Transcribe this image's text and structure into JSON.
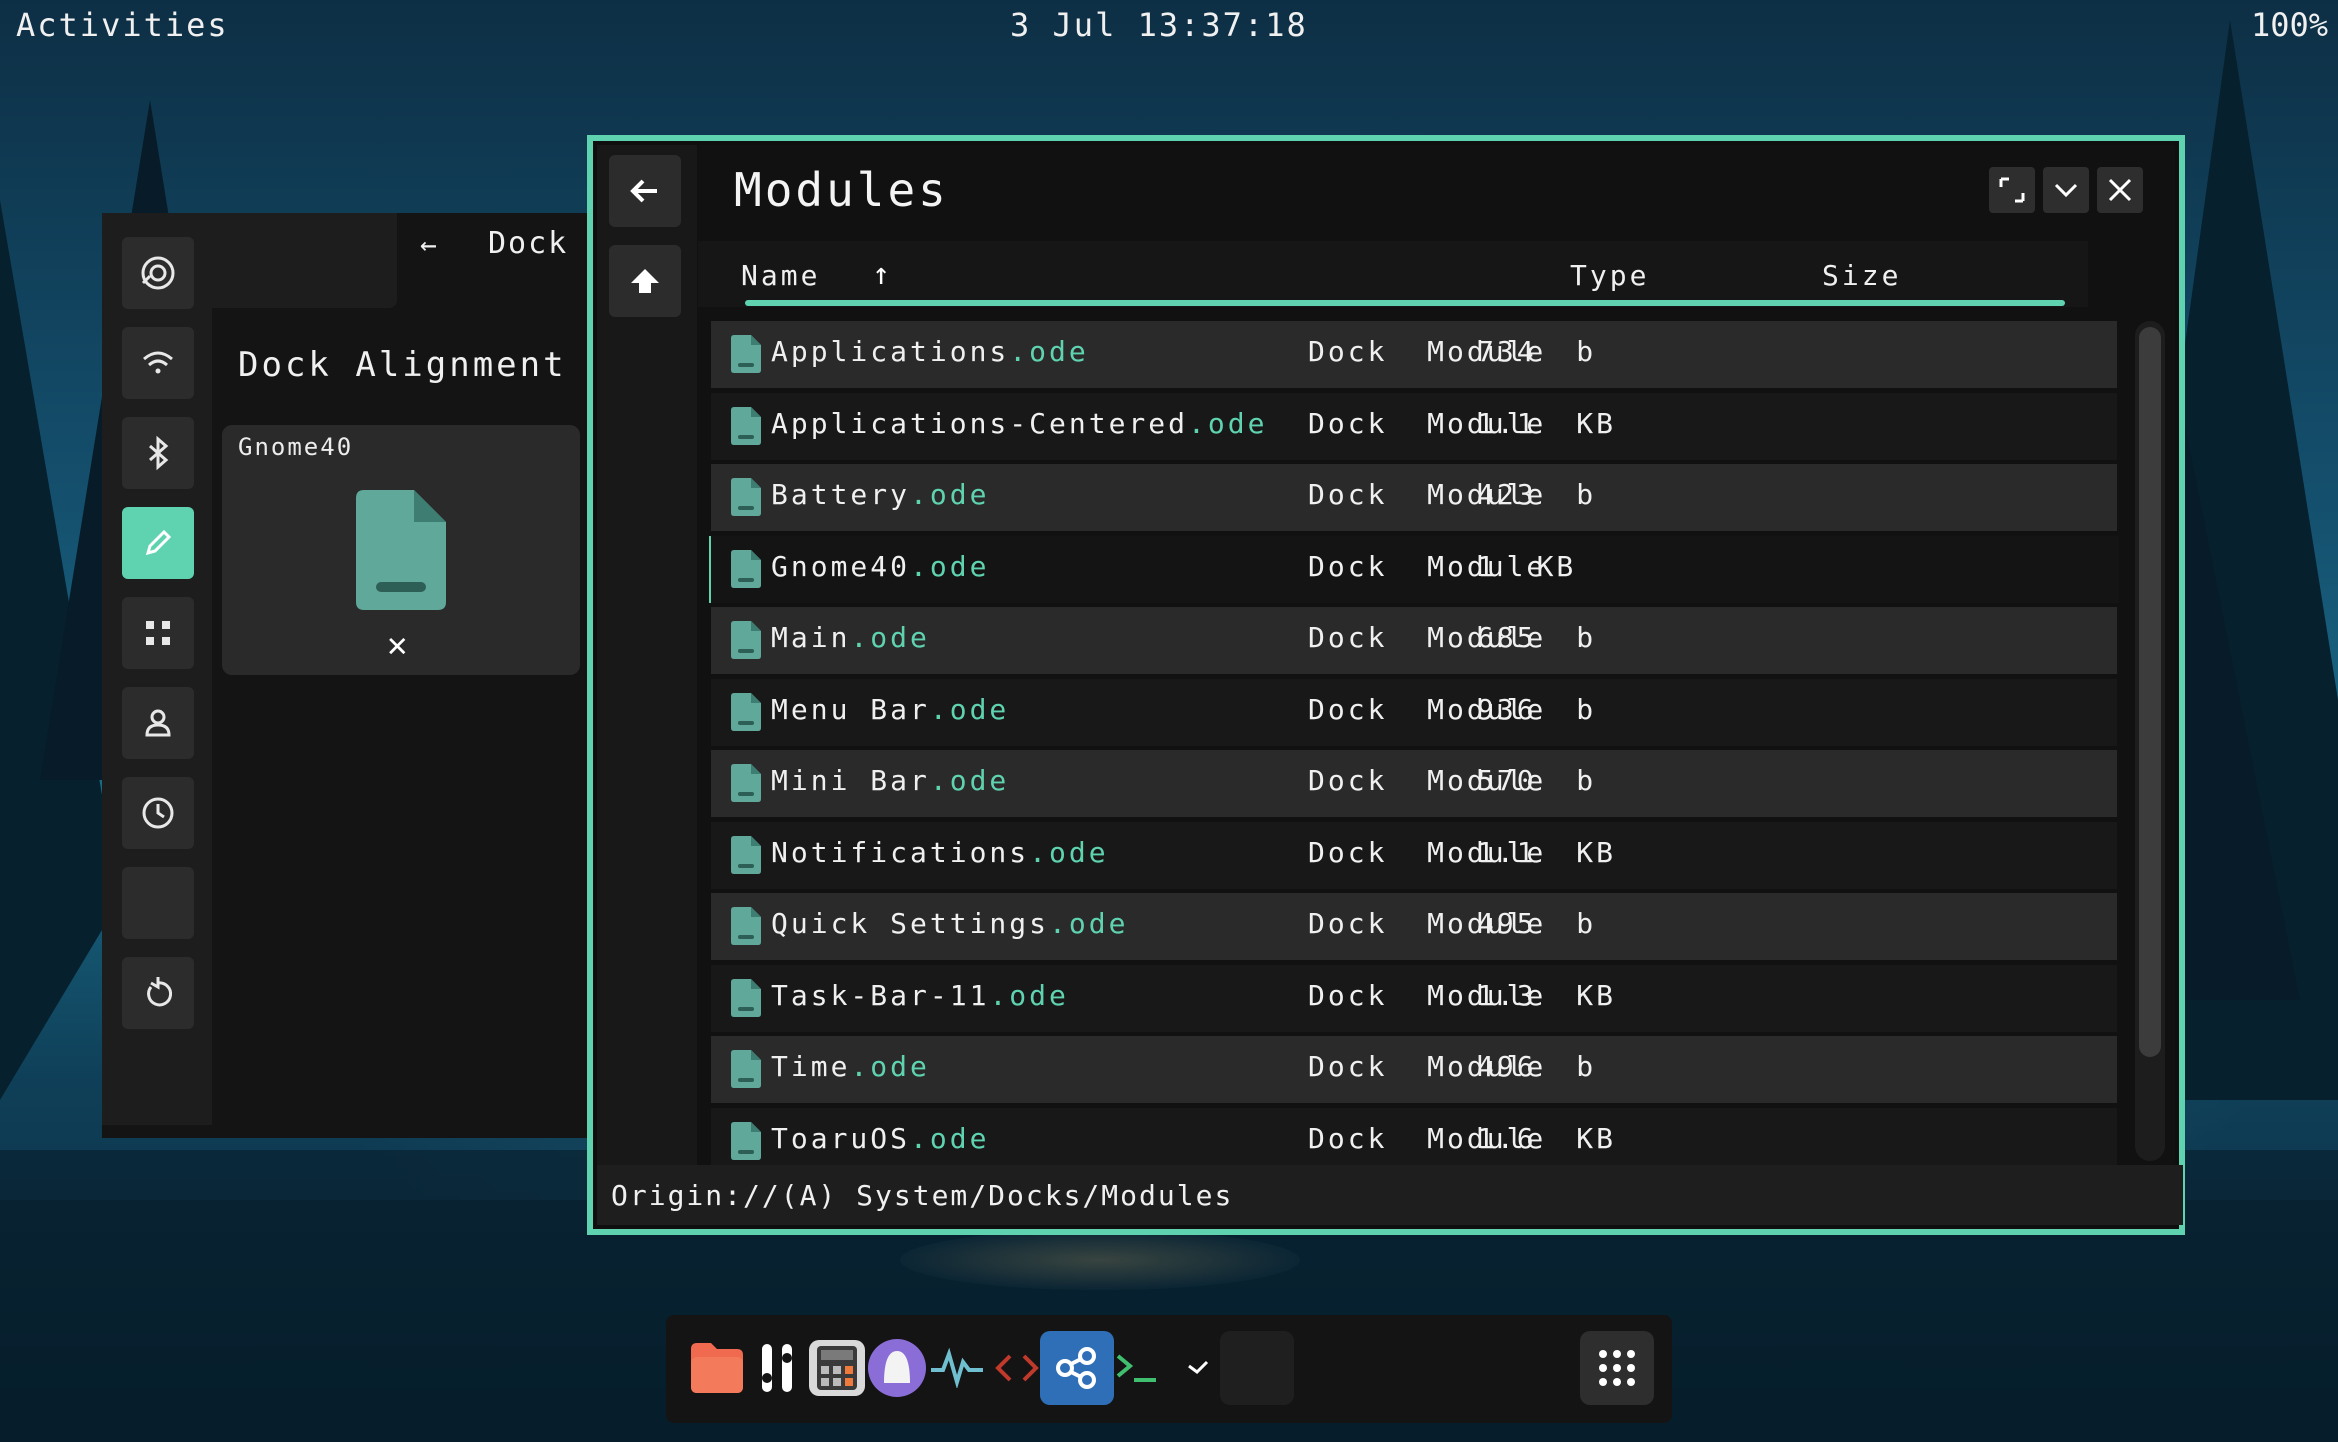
{
  "topbar": {
    "activities": "Activities",
    "clock": "3  Jul  13:37:18",
    "battery": "100%"
  },
  "settings": {
    "back_arrow": "←",
    "title": "Dock",
    "heading": "Dock  Alignment",
    "card": {
      "name": "Gnome40",
      "remove": "✕"
    },
    "rail_icons": [
      "appearance-icon",
      "wifi-icon",
      "bluetooth-icon",
      "pen-icon",
      "apps-grid-icon",
      "user-icon",
      "clock-icon",
      "blank-icon",
      "reset-icon"
    ],
    "active_item": "pen-icon"
  },
  "files": {
    "title": "Modules",
    "columns": {
      "name": "Name",
      "sort_arrow": "↑",
      "type": "Type",
      "size": "Size"
    },
    "rows": [
      {
        "name": "Applications",
        "ext": ".ode",
        "type": "Dock  Module",
        "size": "734  b"
      },
      {
        "name": "Applications-Centered",
        "ext": ".ode",
        "type": "Dock  Module",
        "size": "1.1  KB"
      },
      {
        "name": "Battery",
        "ext": ".ode",
        "type": "Dock  Module",
        "size": "423  b"
      },
      {
        "name": "Gnome40",
        "ext": ".ode",
        "type": "Dock  Module",
        "size": "1  KB"
      },
      {
        "name": "Main",
        "ext": ".ode",
        "type": "Dock  Module",
        "size": "685  b"
      },
      {
        "name": "Menu  Bar",
        "ext": ".ode",
        "type": "Dock  Module",
        "size": "936  b"
      },
      {
        "name": "Mini  Bar",
        "ext": ".ode",
        "type": "Dock  Module",
        "size": "570  b"
      },
      {
        "name": "Notifications",
        "ext": ".ode",
        "type": "Dock  Module",
        "size": "1.1  KB"
      },
      {
        "name": "Quick  Settings",
        "ext": ".ode",
        "type": "Dock  Module",
        "size": "495  b"
      },
      {
        "name": "Task-Bar-11",
        "ext": ".ode",
        "type": "Dock  Module",
        "size": "1.3  KB"
      },
      {
        "name": "Time",
        "ext": ".ode",
        "type": "Dock  Module",
        "size": "496  b"
      },
      {
        "name": "ToaruOS",
        "ext": ".ode",
        "type": "Dock  Module",
        "size": "1.6  KB"
      }
    ],
    "selected_row": "Gnome40",
    "status_path": "Origin://(A)  System/Docks/Modules"
  },
  "colors": {
    "accent": "#5fd3b0",
    "window_bg": "#111111",
    "row_light": "#2a2a2a",
    "row_dark": "#181818"
  },
  "dock": {
    "items": [
      "files-icon",
      "tools-icon",
      "calculator-icon",
      "app-icon",
      "activity-monitor-icon",
      "code-icon",
      "share-icon",
      "terminal-icon",
      "check-icon",
      "blank-icon",
      "app-grid-icon"
    ]
  }
}
